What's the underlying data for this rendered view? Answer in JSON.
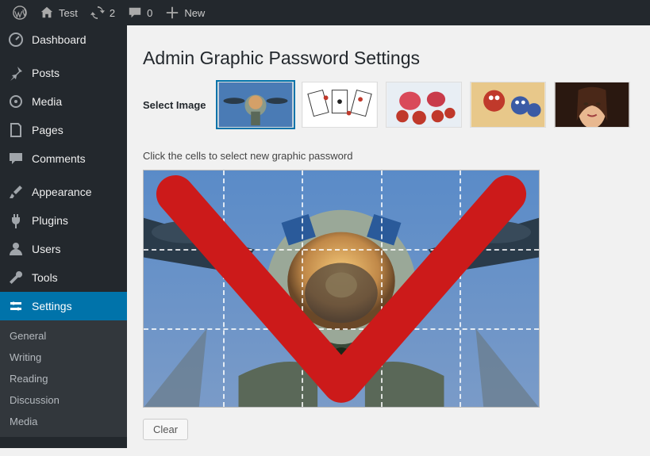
{
  "adminbar": {
    "site_name": "Test",
    "refresh_count": "2",
    "comments_count": "0",
    "new_label": "New"
  },
  "sidebar": {
    "dashboard": "Dashboard",
    "posts": "Posts",
    "media": "Media",
    "pages": "Pages",
    "comments": "Comments",
    "appearance": "Appearance",
    "plugins": "Plugins",
    "users": "Users",
    "tools": "Tools",
    "settings": "Settings",
    "submenu": {
      "general": "General",
      "writing": "Writing",
      "reading": "Reading",
      "discussion": "Discussion",
      "media": "Media"
    }
  },
  "page": {
    "title": "Admin Graphic Password Settings",
    "select_image_label": "Select Image",
    "instruction": "Click the cells to select new graphic password",
    "clear_label": "Clear"
  },
  "thumbs": [
    {
      "name": "pilot"
    },
    {
      "name": "cards"
    },
    {
      "name": "strawberries"
    },
    {
      "name": "characters"
    },
    {
      "name": "woman"
    }
  ]
}
